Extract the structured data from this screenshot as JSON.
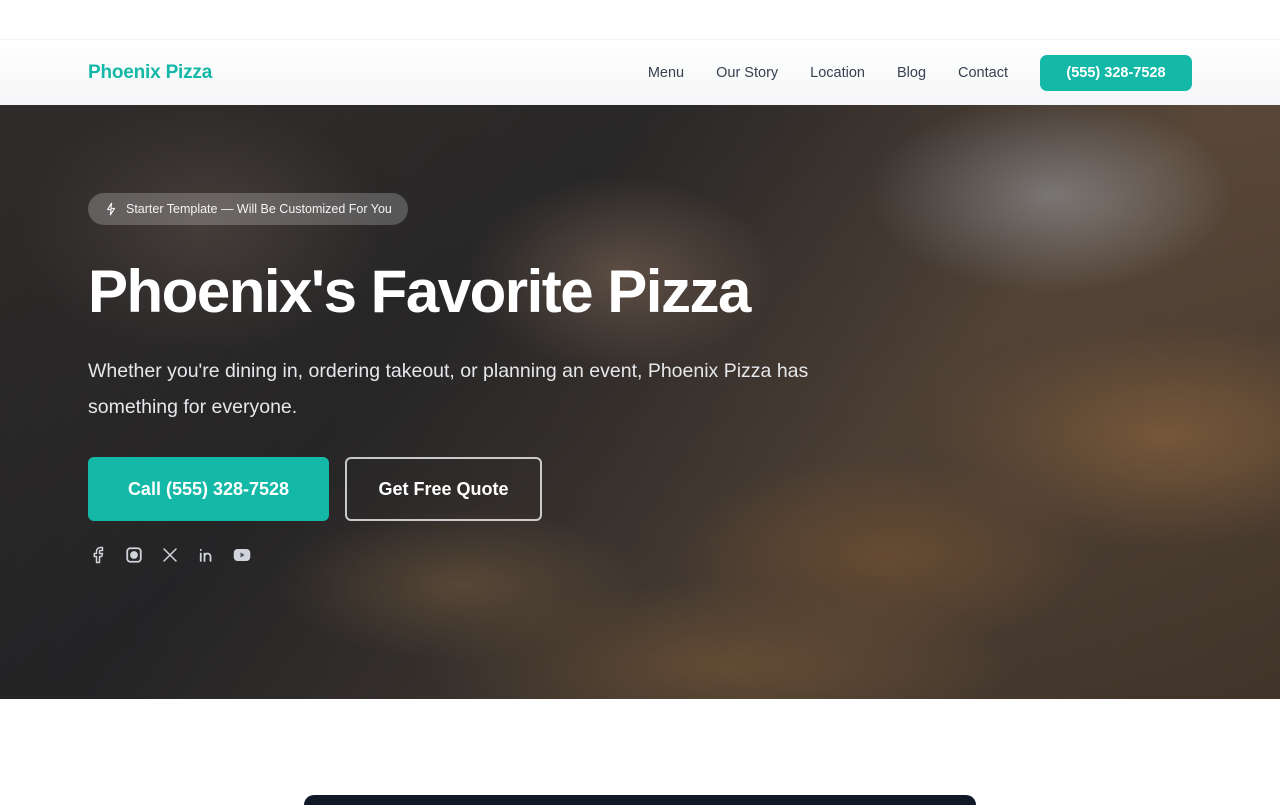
{
  "brand": "Phoenix Pizza",
  "nav": {
    "links": [
      "Menu",
      "Our Story",
      "Location",
      "Blog",
      "Contact"
    ],
    "cta": "(555) 328-7528"
  },
  "hero": {
    "badge": "Starter Template — Will Be Customized For You",
    "title": "Phoenix's Favorite Pizza",
    "subtitle": "Whether you're dining in, ordering takeout, or planning an event, Phoenix Pizza has something for everyone.",
    "primary_cta": "Call (555) 328-7528",
    "secondary_cta": "Get Free Quote",
    "socials": [
      "facebook-icon",
      "instagram-icon",
      "x-icon",
      "linkedin-icon",
      "youtube-icon"
    ]
  },
  "colors": {
    "accent": "#14b8a6",
    "nav_text": "#374151"
  }
}
